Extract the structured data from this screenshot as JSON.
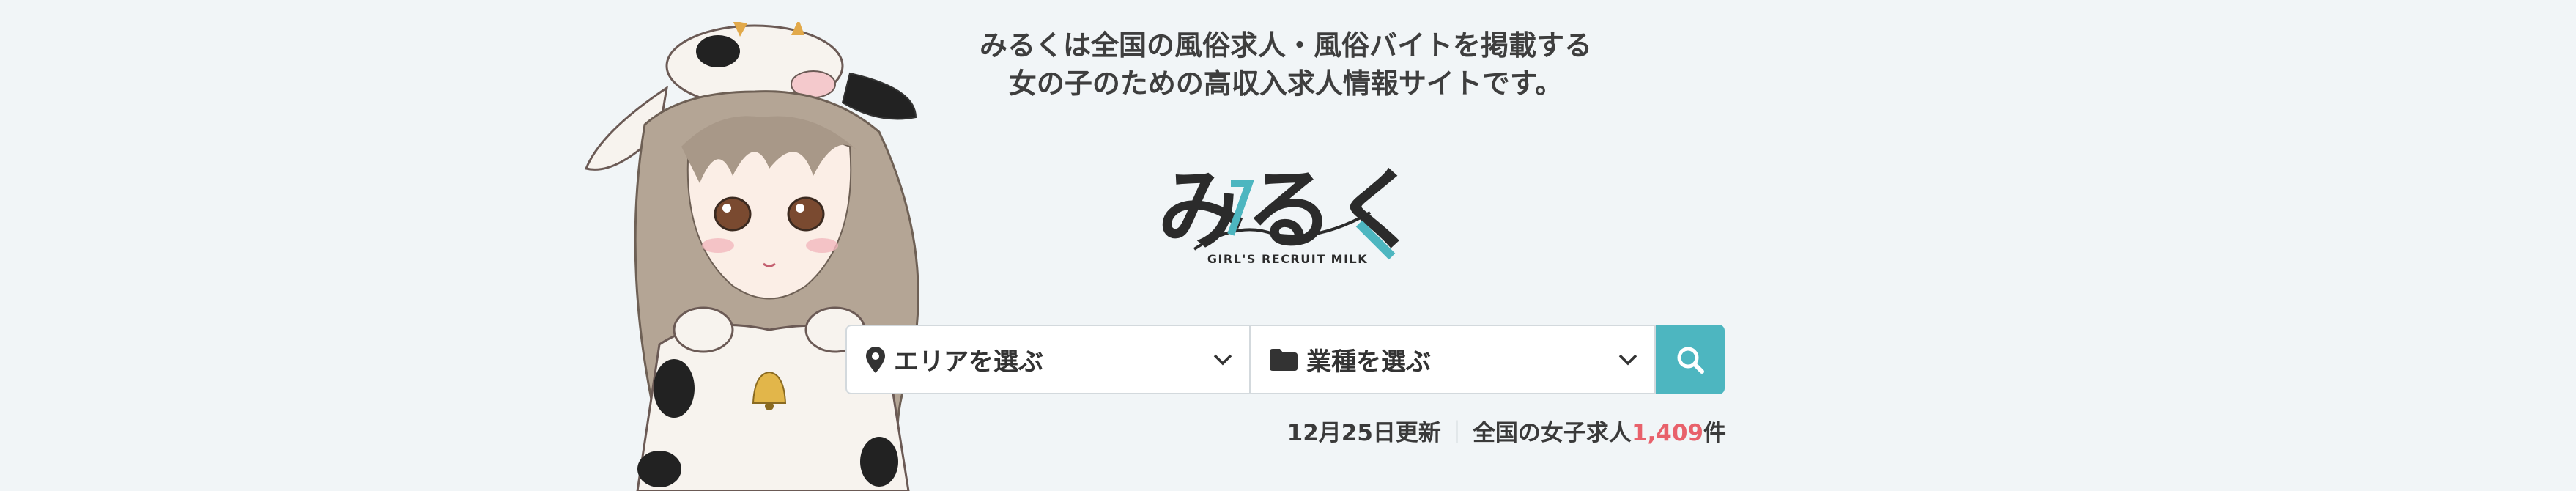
{
  "header": {
    "tagline_line1": "みるくは全国の風俗求人・風俗バイトを掲載する",
    "tagline_line2": "女の子のための高収入求人情報サイトです。"
  },
  "logo": {
    "main_text": "みるく",
    "sub_text": "GIRL'S RECRUIT MILK",
    "accent_color": "#4db6c0",
    "dark_color": "#2b2b2b"
  },
  "search": {
    "area_label": "エリアを選ぶ",
    "area_icon": "map-pin-icon",
    "job_label": "業種を選ぶ",
    "job_icon": "folder-icon",
    "button_icon": "search-icon",
    "button_color": "#4db6c0"
  },
  "stats": {
    "updated": "12月25日更新",
    "separator": "｜",
    "prefix": "全国の女子求人",
    "count": "1,409",
    "suffix": "件",
    "count_color": "#e8616b"
  }
}
